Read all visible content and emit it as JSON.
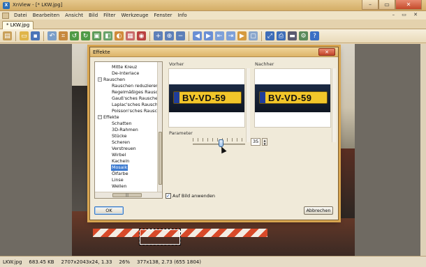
{
  "app": {
    "title": "XnView - [* LKW.jpg]",
    "icon_name": "xnview-logo-icon"
  },
  "window_buttons": {
    "minimize": "–",
    "maximize": "▭",
    "close": "✕"
  },
  "menu": {
    "items": [
      "Datei",
      "Bearbeiten",
      "Ansicht",
      "Bild",
      "Filter",
      "Werkzeuge",
      "Fenster",
      "Info"
    ],
    "right_controls": "– ▭ ✕"
  },
  "tabs": [
    {
      "label": "* LKW.jpg"
    }
  ],
  "toolbar": {
    "icons": [
      "browser-icon",
      "open-folder-icon",
      "save-icon",
      "undo-icon",
      "crop-icon",
      "rotate-left-icon",
      "rotate-right-icon",
      "resize-icon",
      "flip-icon",
      "adjust-icon",
      "filter-icon",
      "effects-icon",
      "redeye-icon",
      "zoom-in-icon",
      "zoom-fit-icon",
      "zoom-out-icon",
      "previous-icon",
      "next-icon",
      "first-icon",
      "last-icon",
      "slideshow-icon",
      "fullscreen-icon",
      "fit-window-icon",
      "print-icon",
      "scanner-icon",
      "options-icon",
      "help-icon"
    ]
  },
  "dialog": {
    "title": "Effekte",
    "close_label": "✕",
    "tree": [
      {
        "label": "Mitte Kreuz",
        "level": 2
      },
      {
        "label": "De-Interlace",
        "level": 2
      },
      {
        "label": "Rauschen",
        "level": 1,
        "expander": "−"
      },
      {
        "label": "Rauschen reduzieren",
        "level": 2
      },
      {
        "label": "Regelmäßiges Rauschen",
        "level": 2
      },
      {
        "label": "Gauß'sches Rauschen h",
        "level": 2
      },
      {
        "label": "Laplac'sches Rauschen",
        "level": 2
      },
      {
        "label": "Poisson'sches Rauschen",
        "level": 2
      },
      {
        "label": "Effekte",
        "level": 1,
        "expander": "−"
      },
      {
        "label": "Schatten",
        "level": 2
      },
      {
        "label": "3D-Rahmen",
        "level": 2
      },
      {
        "label": "Stücke",
        "level": 2
      },
      {
        "label": "Scheren",
        "level": 2
      },
      {
        "label": "Verstreuen",
        "level": 2
      },
      {
        "label": "Wirbel",
        "level": 2
      },
      {
        "label": "Kacheln",
        "level": 2
      },
      {
        "label": "Mosaik",
        "level": 2,
        "selected": true
      },
      {
        "label": "Ölfarbe",
        "level": 2
      },
      {
        "label": "Linse",
        "level": 2
      },
      {
        "label": "Wellen",
        "level": 2
      }
    ],
    "tree_hscroll_grip": "|||",
    "preview_before_label": "Vorher",
    "preview_after_label": "Nachher",
    "plate_text": "BV-VD-59",
    "parameter_label": "Parameter",
    "parameter_value": "35",
    "spin_up": "▲",
    "spin_down": "▼",
    "apply_checkbox_label": "Auf Bild anwenden",
    "apply_checked": true,
    "check_mark": "✓",
    "ok_label": "OK",
    "cancel_label": "Abbrechen"
  },
  "status": {
    "filename": "LKW.jpg",
    "filesize": "683.45 KB",
    "dimensions": "2707x2043x24, 1.33",
    "zoom": "26%",
    "selection": "377x138, 2.73 (655 1804)"
  },
  "colors": {
    "accent": "#3d7bd0",
    "window_frame": "#d8a550",
    "close_red": "#c3452a",
    "plate_yellow": "#f2c62a"
  }
}
